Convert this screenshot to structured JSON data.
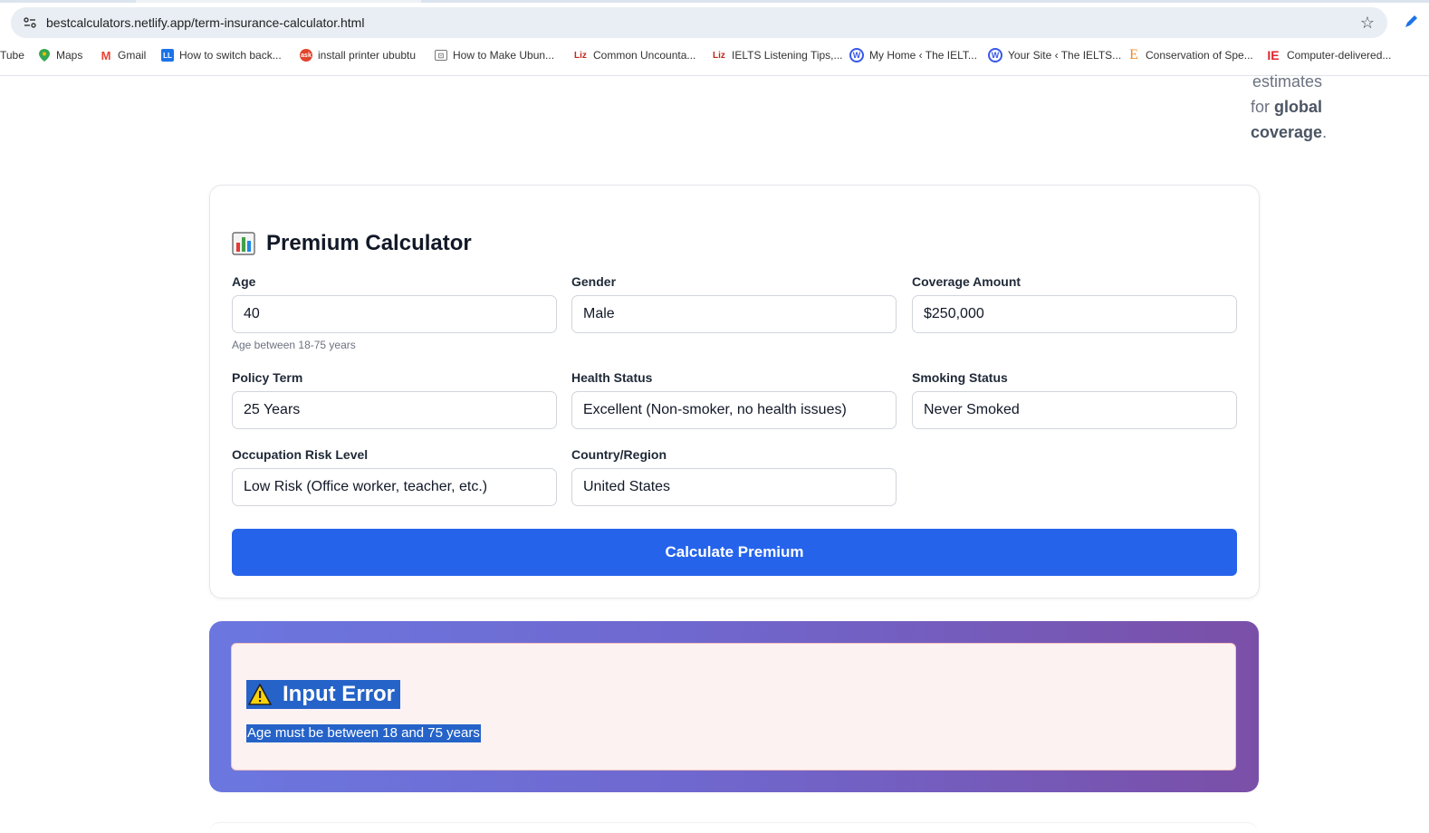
{
  "browser": {
    "url": "bestcalculators.netlify.app/term-insurance-calculator.html",
    "bookmarks": [
      {
        "label": "Tube",
        "icon": "youtube-icon"
      },
      {
        "label": "Maps",
        "icon": "maps-icon"
      },
      {
        "label": "Gmail",
        "icon": "gmail-icon"
      },
      {
        "label": "How to switch back...",
        "icon": "page-icon"
      },
      {
        "label": "install printer ububtu",
        "icon": "ask-icon"
      },
      {
        "label": "How to Make Ubun...",
        "icon": "page-icon"
      },
      {
        "label": "Common Uncounta...",
        "icon": "liz-icon"
      },
      {
        "label": "IELTS Listening Tips,...",
        "icon": "liz-icon"
      },
      {
        "label": "My Home ‹ The IELT...",
        "icon": "wordpress-icon"
      },
      {
        "label": "Your Site ‹ The IELTS...",
        "icon": "wordpress-icon"
      },
      {
        "label": "Conservation of Spe...",
        "icon": "e-icon"
      },
      {
        "label": "Computer-delivered...",
        "icon": "ie-icon"
      }
    ]
  },
  "side_snippet": {
    "line1": "estimates",
    "line2_prefix": "for ",
    "line2_bold": "global",
    "line3_bold": "coverage",
    "line3_suffix": "."
  },
  "calculator": {
    "title": "Premium Calculator",
    "fields": {
      "age": {
        "label": "Age",
        "value": "40",
        "hint": "Age between 18-75 years"
      },
      "gender": {
        "label": "Gender",
        "value": "Male"
      },
      "coverage": {
        "label": "Coverage Amount",
        "value": "$250,000"
      },
      "policy_term": {
        "label": "Policy Term",
        "value": "25 Years"
      },
      "health": {
        "label": "Health Status",
        "value": "Excellent (Non-smoker, no health issues)"
      },
      "smoking": {
        "label": "Smoking Status",
        "value": "Never Smoked"
      },
      "occupation": {
        "label": "Occupation Risk Level",
        "value": "Low Risk (Office worker, teacher, etc.)"
      },
      "country": {
        "label": "Country/Region",
        "value": "United States"
      }
    },
    "button_label": "Calculate Premium"
  },
  "error": {
    "title": "Input Error",
    "message": "Age must be between 18 and 75 years"
  },
  "colors": {
    "primary": "#2563eb",
    "gradient_start": "#6b77df",
    "gradient_end": "#7a4fa8",
    "error_bg": "#fdf2f2",
    "selection": "#2563c9"
  }
}
